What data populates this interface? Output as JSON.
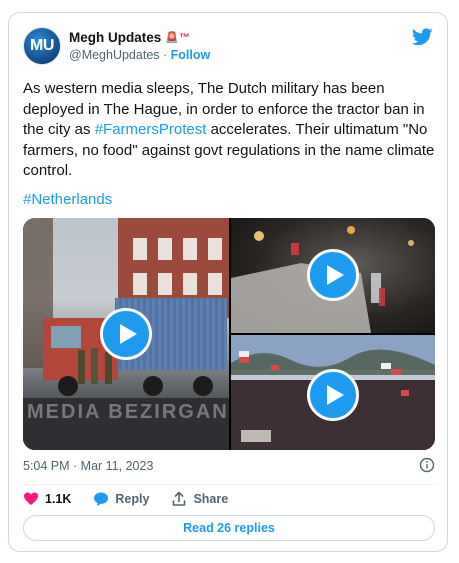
{
  "author": {
    "avatar_text": "MU",
    "display_name": "Megh Updates",
    "flair": "🚨™",
    "handle": "@MeghUpdates",
    "separator": "·",
    "follow_label": "Follow"
  },
  "tweet": {
    "text_before": "As western media sleeps, The Dutch military has been deployed in The Hague, in order to enforce the tractor ban in the city as ",
    "inline_hashtag": "#FarmersProtest",
    "text_after": " accelerates. Their ultimatum \"No farmers, no food\" against govt regulations in the name climate control.",
    "hashtag": "#Netherlands",
    "timestamp": "5:04 PM · Mar 11, 2023"
  },
  "media": {
    "watermark": "MEDIA BEZIRGAN",
    "videos": [
      "main-video",
      "night-video",
      "crowd-video"
    ]
  },
  "actions": {
    "like_count": "1.1K",
    "reply_label": "Reply",
    "share_label": "Share"
  },
  "read_replies_label": "Read 26 replies",
  "colors": {
    "accent": "#1d9bf0",
    "like": "#f91880",
    "text": "#0f1419",
    "muted": "#536471"
  }
}
